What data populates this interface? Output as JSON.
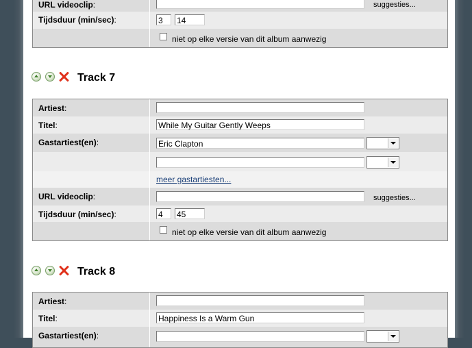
{
  "labels": {
    "artist": "Artiest",
    "title": "Titel",
    "guest": "Gastartiest(en)",
    "url": "URL videoclip",
    "duration": "Tijdsduur (min/sec)",
    "suggestions": "suggesties...",
    "not_every_version": "niet op elke versie van dit album aanwezig",
    "more_guests": "meer gastartiesten...",
    "colon": ":"
  },
  "track6": {
    "minutes": "3",
    "seconds": "14"
  },
  "track7": {
    "heading": "Track 7",
    "artist": "",
    "title": "While My Guitar Gently Weeps",
    "guest1": "Eric Clapton",
    "guest2": "",
    "url": "",
    "minutes": "4",
    "seconds": "45"
  },
  "track8": {
    "heading": "Track 8",
    "artist": "",
    "title": "Happiness Is a Warm Gun",
    "guest1": ""
  }
}
